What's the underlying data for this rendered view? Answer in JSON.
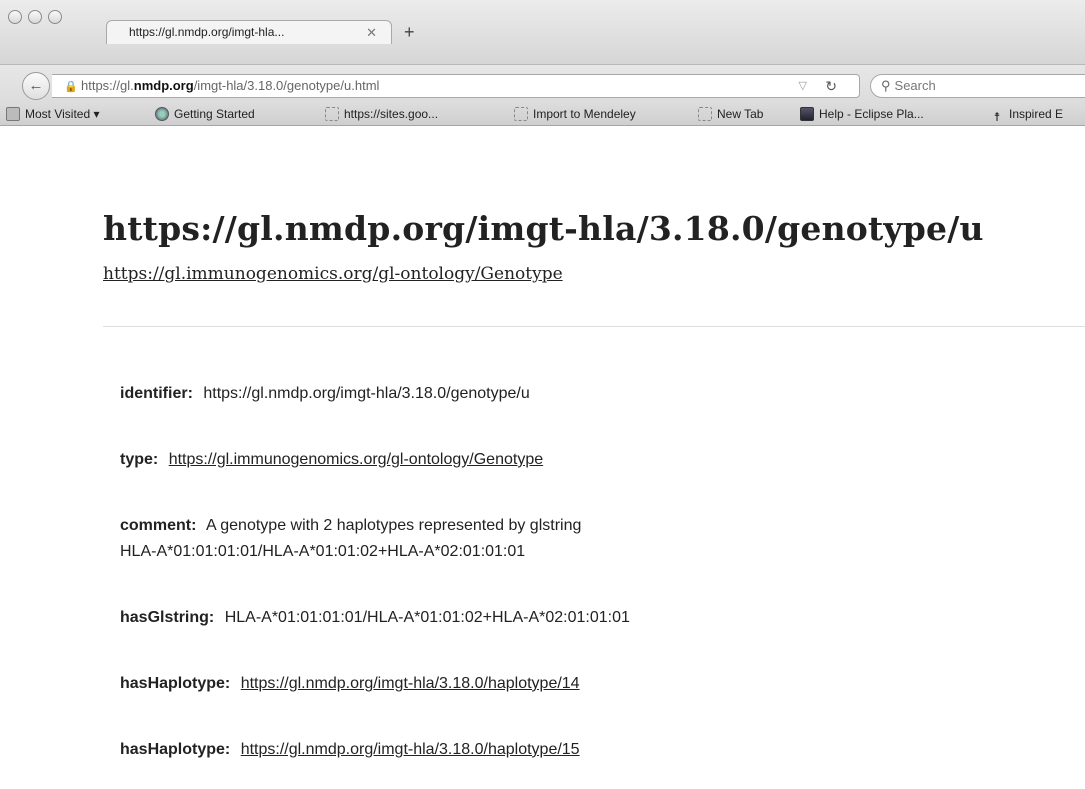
{
  "tab": {
    "title": "https://gl.nmdp.org/imgt-hla...",
    "close": "✕",
    "new": "+"
  },
  "url": {
    "scheme": "https://gl.",
    "host": "nmdp.org",
    "path": "/imgt-hla/3.18.0/genotype/u.html"
  },
  "search": {
    "placeholder": "Search"
  },
  "bookmarks": [
    {
      "label": "Most Visited ▾",
      "icon": "folder-icon"
    },
    {
      "label": "Getting Started",
      "icon": "globe-icon"
    },
    {
      "label": "https://sites.goo...",
      "icon": "page-icon"
    },
    {
      "label": "Import to Mendeley",
      "icon": "page-icon"
    },
    {
      "label": "New Tab",
      "icon": "page-icon"
    },
    {
      "label": "Help - Eclipse Pla...",
      "icon": "eclipse-icon"
    },
    {
      "label": "Inspired E",
      "icon": "inspired-icon"
    }
  ],
  "page": {
    "title": "https://gl.nmdp.org/imgt-hla/3.18.0/genotype/u",
    "subtitle": "https://gl.immunogenomics.org/gl-ontology/Genotype",
    "properties": [
      {
        "key": "identifier:",
        "value": "https://gl.nmdp.org/imgt-hla/3.18.0/genotype/u"
      },
      {
        "key": "type:",
        "value": "https://gl.immunogenomics.org/gl-ontology/Genotype"
      },
      {
        "key": "comment:",
        "value": "A genotype with 2 haplotypes represented by glstring",
        "value2": "HLA-A*01:01:01:01/HLA-A*01:01:02+HLA-A*02:01:01:01"
      },
      {
        "key": "hasGlstring:",
        "value": "HLA-A*01:01:01:01/HLA-A*01:01:02+HLA-A*02:01:01:01"
      },
      {
        "key": "hasHaplotype:",
        "value": "https://gl.nmdp.org/imgt-hla/3.18.0/haplotype/14"
      },
      {
        "key": "hasHaplotype:",
        "value": "https://gl.nmdp.org/imgt-hla/3.18.0/haplotype/15"
      }
    ]
  }
}
